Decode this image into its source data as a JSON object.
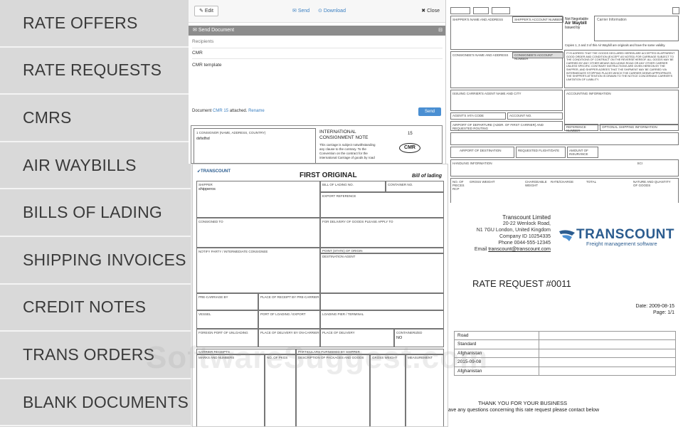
{
  "sidebar": {
    "items": [
      {
        "label": "RATE OFFERS"
      },
      {
        "label": "RATE REQUESTS"
      },
      {
        "label": "CMRS"
      },
      {
        "label": "AIR WAYBILLS"
      },
      {
        "label": "BILLS OF LADING"
      },
      {
        "label": "SHIPPING INVOICES"
      },
      {
        "label": "CREDIT NOTES"
      },
      {
        "label": "TRANS ORDERS"
      },
      {
        "label": "BLANK DOCUMENTS"
      }
    ]
  },
  "send_panel": {
    "edit_label": "Edit",
    "send_label": "Send",
    "download_label": "Download",
    "close_label": "Close",
    "header": "Send Document",
    "recipients_label": "Recipients",
    "subject_value": "CMR",
    "body_value": "CMR template",
    "attach_prefix": "Document",
    "attach_link": "CMR 15",
    "attach_suffix": "attached.",
    "rename_label": "Rename",
    "send_button": "Send"
  },
  "cmr": {
    "consignor_label": "1 CONSIGNOR (NAME, ADDRESS, COUNTRY)",
    "consignor_value": "dsfsdfsd",
    "title1": "INTERNATIONAL",
    "title2": "CONSIGNMENT NOTE",
    "number": "15",
    "stamp": "CMR",
    "note1": "This carriage is subject notwithstanding",
    "note2": "any clause to the contrary. To the",
    "note3": "Convention on the contract for the",
    "note4": "international Carriage of goods by road"
  },
  "awb": {
    "shipper_label": "SHIPPER'S NAME AND ADDRESS",
    "shipper_acct_label": "SHIPPER'S ACCOUNT NUMBER",
    "not_negotiable": "Not Negotiable",
    "title": "Air Waybill",
    "issued_by": "Issued by",
    "carrier_info": "Carrier Information",
    "copies_note": "Copies 1, 2 and 3 of this Air Waybill are originals and have the same validity.",
    "consignee_label": "CONSIGNEE'S NAME AND ADDRESS",
    "consignee_acct_label": "CONSIGNEE'S ACCOUNT NUMBER",
    "terms": "It is agreed that the goods declared herein are accepted in apparent good order and condition (except as noted) for carriage SUBJECT TO THE CONDITIONS OF CONTRACT ON THE REVERSE HEREOF. ALL GOODS MAY BE CARRIED BY ANY OTHER MEANS INCLUDING ROAD OR ANY OTHER CARRIER UNLESS SPECIFIC CONTRARY INSTRUCTIONS ARE GIVEN HEREON BY THE SHIPPER, AND SHIPPER AGREES THAT THE SHIPMENT MAY BE CARRIED VIA INTERMEDIATE STOPPING PLACES WHICH THE CARRIER DEEMS APPROPRIATE. THE SHIPPER'S ATTENTION IS DRAWN TO THE NOTICE CONCERNING CARRIER'S LIMITATION OF LIABILITY.",
    "issuing_agent_label": "ISSUING CARRIER'S AGENT NAME AND CITY",
    "accounting_label": "ACCOUNTING INFORMATION",
    "iata_label": "AGENT'S IATA CODE",
    "account_no_label": "ACCOUNT NO.",
    "departure_label": "AIRPORT OF DEPARTURE (ADDR. OF FIRST CARRIER) AND REQUESTED ROUTING",
    "reference_label": "REFERENCE NUMBER",
    "optional_label": "OPTIONAL SHIPPING INFORMATION",
    "destination_label": "AIRPORT OF DESTINATION",
    "flight_label": "REQUESTED FLIGHT/DATE",
    "insurance_label": "AMOUNT OF INSURANCE",
    "handling_label": "HANDLING INFORMATION",
    "sci_label": "SCI",
    "pieces_label": "NO. OF PIECES RCP",
    "gross_label": "GROSS WEIGHT",
    "chargeable_label": "CHARGEABLE WEIGHT",
    "rate_label": "RATE/CHARGE",
    "total_label": "TOTAL",
    "nature_label": "NATURE AND QUANTITY OF GOODS"
  },
  "bol": {
    "logo": "TRANSCOUNT",
    "title": "FIRST ORIGINAL",
    "subtitle": "Bill of lading",
    "shipper_label": "SHIPPER",
    "shipper_value": "shipperos",
    "bl_no_label": "BILL OF LADING NO.",
    "container_label": "CONTAINER NO.",
    "export_ref_label": "EXPORT REFERENCE",
    "consigned_label": "CONSIGNED TO",
    "delivery_apply_label": "FOR DELIVERY OF GOODS PLEASE APPLY TO",
    "notify_label": "NOTIFY PARTY / INTERMEDIATE CONSIGNEE",
    "origin_point_label": "POINT (STATE) OF ORIGIN",
    "destination_agent_label": "DESTINATION AGENT",
    "pre_carriage_label": "PRE-CARRIAGE BY",
    "receipt_label": "PLACE OF RECEIPT BY PRE-CARRIER",
    "vessel_label": "VESSEL",
    "loading_port_label": "PORT OF LOADING / EXPORT",
    "loading_pier_label": "LOADING PIER / TERMINAL",
    "discharge_label": "FOREIGN PORT OF UNLOADING",
    "delivery_carrier_label": "PLACE OF DELIVERY BY ON-CARRIER",
    "delivery_place_label": "PLACE OF DELIVERY",
    "containerized_label": "CONTAINERIZED",
    "containerized_value": "NO",
    "carrier_receipt_label": "CARRIER RECEIPTS",
    "particulars_label": "PARTICULARS FURNISHED BY SHIPPER",
    "marks_label": "MARKS AND NUMBERS",
    "pkgs_label": "NO. OF PKGS",
    "description_label": "DESCRIPTION OF PACKAGES AND GOODS",
    "gross_label": "GROSS WEIGHT",
    "measurement_label": "MEASUREMENT"
  },
  "rate_request": {
    "company": "Transcount Limited",
    "street": "20-22 Wenlock Road,",
    "city": "N1 7GU London, United Kingdom",
    "company_id": "Company ID 10254335",
    "phone": "Phone 0044-555-12345",
    "email_prefix": "Email",
    "email": "transcount@transcount.com",
    "logo_word": "TRANSCOUNT",
    "logo_sub": "Freight management software",
    "title": "RATE REQUEST #0011",
    "date": "Date: 2009-08-15",
    "page": "Page: 1/1",
    "rows": [
      "Road",
      "Standard",
      "Afghanistan",
      "2015-09-08",
      "Afghanistan"
    ],
    "thanks": "THANK YOU FOR YOUR BUSINESS",
    "contact": "ave any questions concerning this rate request please contact below"
  },
  "watermark": "SoftwareSuggest.com"
}
